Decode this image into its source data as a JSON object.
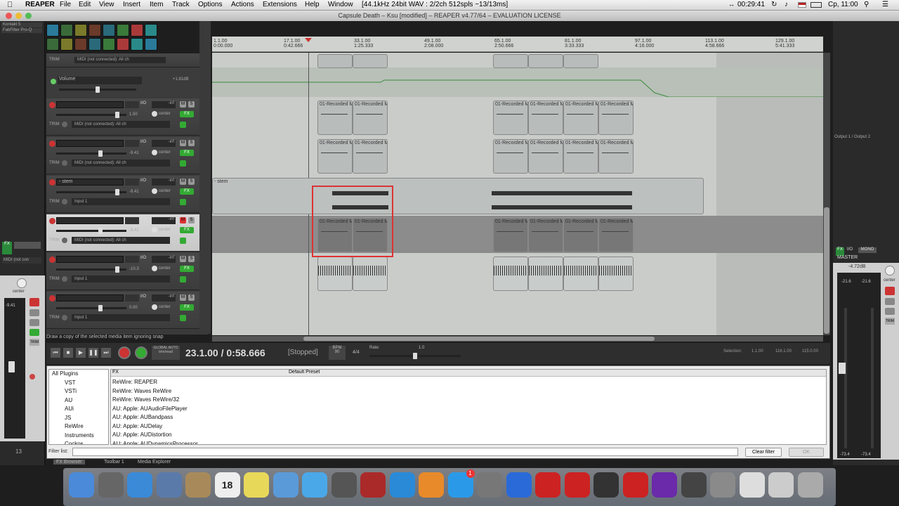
{
  "menubar": {
    "app": "REAPER",
    "items": [
      "File",
      "Edit",
      "View",
      "Insert",
      "Item",
      "Track",
      "Options",
      "Actions",
      "Extensions",
      "Help",
      "Window"
    ],
    "info": "[44.1kHz 24bit WAV : 2/2ch 512spls ~13/13ms]",
    "clock": "00:29:41",
    "datetime": "Ср, 11:00"
  },
  "window": {
    "title": "Capsule Death – Ksu [modified] – REAPER v4.77/64 – EVALUATION LICENSE"
  },
  "left_panel": {
    "plugin1": "Kontakt 5",
    "plugin2": "FabFilter Pro-Q",
    "midi": "MIDI (not con",
    "pan": "center",
    "vol": "-9.41",
    "track_num": "13"
  },
  "ruler": {
    "marks": [
      {
        "bar": "1.1.00",
        "time": "0:00.000"
      },
      {
        "bar": "17.1.00",
        "time": "0:42.666"
      },
      {
        "bar": "33.1.00",
        "time": "1:25.333"
      },
      {
        "bar": "49.1.00",
        "time": "2:08.000"
      },
      {
        "bar": "65.1.00",
        "time": "2:50.666"
      },
      {
        "bar": "81.1.00",
        "time": "3:33.333"
      },
      {
        "bar": "97.1.00",
        "time": "4:16.000"
      },
      {
        "bar": "113.1.00",
        "time": "4:58.666"
      },
      {
        "bar": "129.1.00",
        "time": "5:41.333"
      }
    ]
  },
  "tracks": {
    "top_input": "MIDI (not connected): All ch",
    "envelope": {
      "name": "Volume",
      "value": "+1.81dB"
    },
    "rows": [
      {
        "num": "10",
        "name": "",
        "vol": "-inf",
        "db": "1.50",
        "pan": "center",
        "input": "MIDI (not connected): All ch"
      },
      {
        "num": "11",
        "name": "",
        "vol": "-inf",
        "db": "-9.41",
        "pan": "center",
        "input": "MIDI (not connected): All ch"
      },
      {
        "num": "12",
        "name": "- stem",
        "vol": "-inf",
        "db": "-9.41",
        "pan": "center",
        "input": "Input 1"
      },
      {
        "num": "13",
        "name": "",
        "vol": "-inf",
        "db": "-9.41",
        "pan": "center",
        "input": "MIDI (not connected): All ch"
      },
      {
        "num": "14",
        "name": "",
        "vol": "-inf",
        "db": "-10.3",
        "pan": "center",
        "input": "Input 1"
      },
      {
        "num": "15",
        "name": "",
        "vol": "-inf",
        "db": "0.00",
        "pan": "center",
        "input": "Input 1"
      }
    ],
    "labels": {
      "trim": "TRIM",
      "io": "I/O",
      "m": "M",
      "s": "S",
      "fx": "FX",
      "phase": "ø"
    }
  },
  "items": {
    "recorded": "01-Recorded M",
    "stem_folder": "- stem"
  },
  "status_hint": "Draw a copy of the selected media item ignoring snap",
  "transport": {
    "position": "23.1.00 / 0:58.666",
    "state": "[Stopped]",
    "bpm_label": "BPM",
    "bpm": "90",
    "sig": "4/4",
    "rate_label": "Rate:",
    "rate": "1.0",
    "global_auto": "GLOBAL AUTO",
    "trim_read": "trim/read",
    "selection_label": "Selection:",
    "sel_start": "1.1.00",
    "sel_end": "116.1.00",
    "sel_len": "115.0.00"
  },
  "master": {
    "label": "MASTER",
    "io": "I/O",
    "mono": "MONO",
    "output": "Output 1 / Output 2",
    "db": "-4.72dB",
    "pan": "center",
    "peak_l": "-21.6",
    "peak_r": "-21.6",
    "bot_l": "-73.4",
    "bot_r": "-73.4",
    "fx": "FX"
  },
  "fx_browser": {
    "col_fx": "FX",
    "col_preset": "Default Preset",
    "categories": [
      "All Plugins",
      "VST",
      "VSTi",
      "AU",
      "AUi",
      "JS",
      "ReWire",
      "Instruments",
      "Cockos"
    ],
    "plugins": [
      "ReWire: REAPER",
      "ReWire: Waves ReWire",
      "ReWire: Waves ReWire/32",
      "AU: Apple: AUAudioFilePlayer",
      "AU: Apple: AUBandpass",
      "AU: Apple: AUDelay",
      "AU: Apple: AUDistortion",
      "AU: Apple: AUDynamicsProcessor"
    ],
    "filter_label": "Filter list:",
    "filter_value": "",
    "clear_filter": "Clear filter",
    "ok": "OK",
    "tabs": [
      "FX Browser",
      "Toolbar 1",
      "Media Explorer"
    ]
  },
  "dock": {
    "calendar_day": "18",
    "badge": "1"
  },
  "meter_scale": [
    "12",
    "6",
    "0",
    "-6",
    "-12",
    "-18",
    "-24",
    "-30",
    "-36",
    "-42",
    "-48",
    "-54",
    "-60"
  ]
}
